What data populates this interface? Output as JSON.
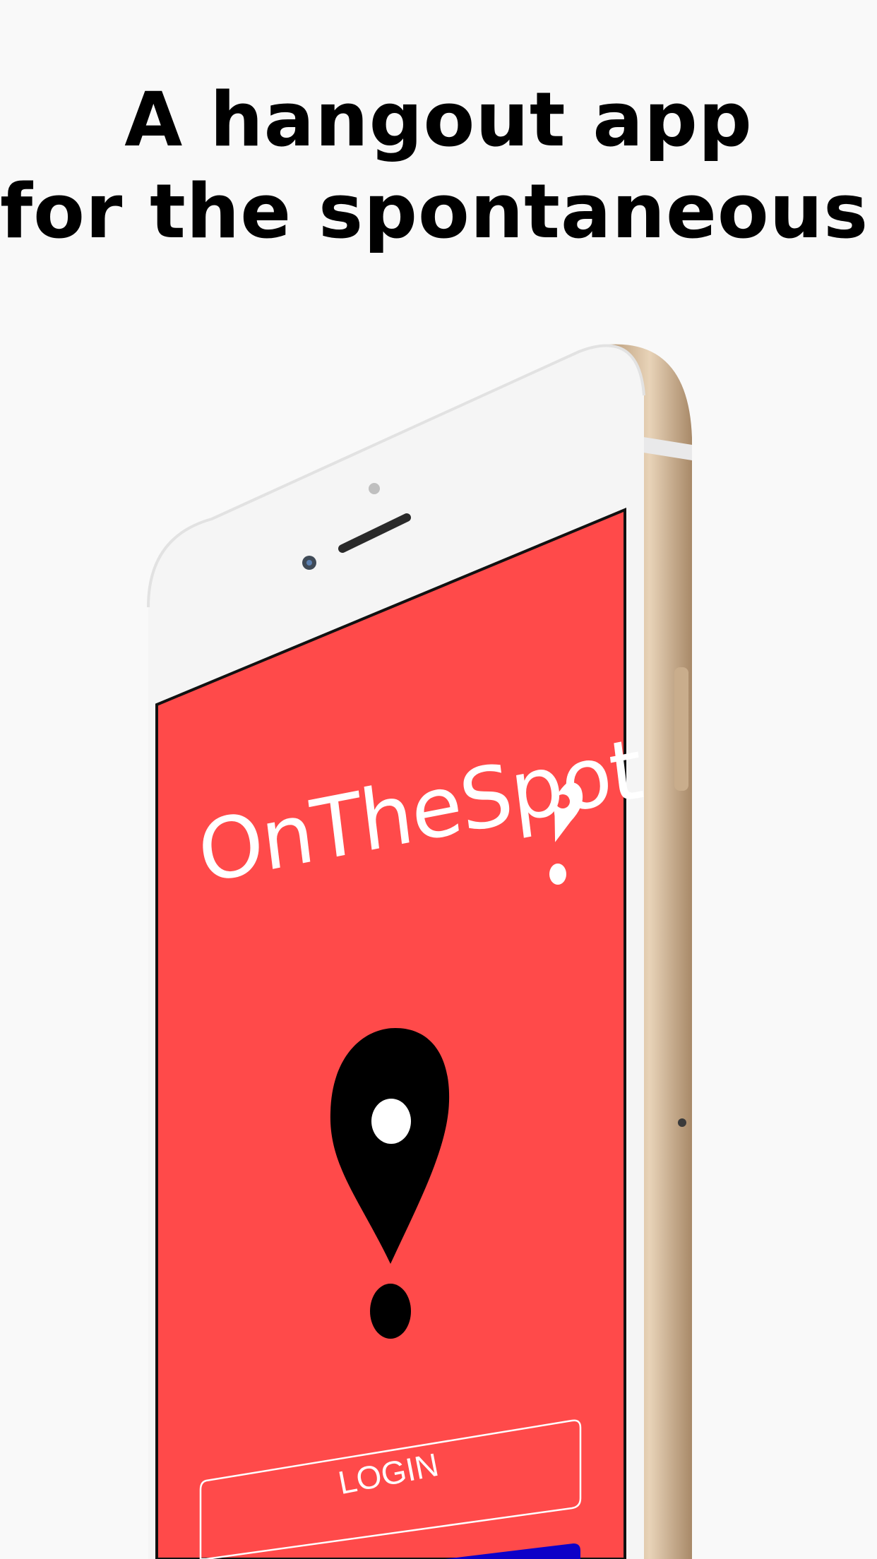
{
  "headline": {
    "line1": "A hangout app",
    "line2": "for the spontaneous!"
  },
  "app": {
    "title": "OnTheSpot",
    "login_label": "LOGIN"
  },
  "colors": {
    "background": "#f9f9f9",
    "screen": "#ff4a4a",
    "phone_frame": "#d9bfa0",
    "accent_bar": "#0d00c8",
    "pin": "#000000"
  },
  "icons": {
    "title_pin": "map-pin-icon",
    "logo": "map-pin-exclamation-icon"
  }
}
